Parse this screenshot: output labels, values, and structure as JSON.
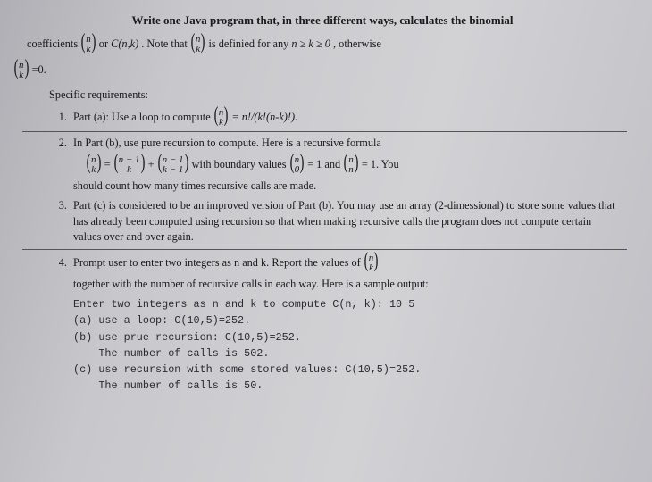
{
  "title": "Write one Java program that, in three different ways, calculates the binomial",
  "intro": {
    "coeff": "coefficients ",
    "or": " or ",
    "cnk": "C(n,k)",
    "note": ".  Note that ",
    "defined": " is definied for any ",
    "cond": "n ≥ k ≥ 0",
    "otherwise": ", otherwise",
    "eq_zero": " =0."
  },
  "binom_nk_top": "n",
  "binom_nk_bot": "k",
  "spec_head": "Specific requirements:",
  "items": {
    "a": {
      "lead": "Part (a): Use a loop to compute ",
      "formula": " = n!/(k!(n-k)!)."
    },
    "b": {
      "lead": "In Part (b), use pure recursion to compute.  Here is a recursive formula",
      "with_bound": "with boundary values ",
      "eq1": " = 1 and ",
      "eq1end": " = 1.  You",
      "tail": "should count how many times recursive calls are made.",
      "b1_top": "n − 1",
      "b1_bot": "k",
      "b2_top": "n − 1",
      "b2_bot": "k − 1",
      "bv1_top": "n",
      "bv1_bot": "0",
      "bv2_top": "n",
      "bv2_bot": "n"
    },
    "c": "Part (c) is considered to be an improved version of Part (b).  You may use an array (2-dimessional) to store some values that has already been computed using recursion so that when making recursive calls the program does not compute certain values over and over again.",
    "d": {
      "lead": "Prompt user to enter two integers as n and k.  Report the values of ",
      "tail": "together with the number of recursive calls in each way.  Here is a sample output:"
    }
  },
  "output": "Enter two integers as n and k to compute C(n, k): 10 5\n(a) use a loop: C(10,5)=252.\n(b) use prue recursion: C(10,5)=252.\n    The number of calls is 502.\n(c) use recursion with some stored values: C(10,5)=252.\n    The number of calls is 50."
}
